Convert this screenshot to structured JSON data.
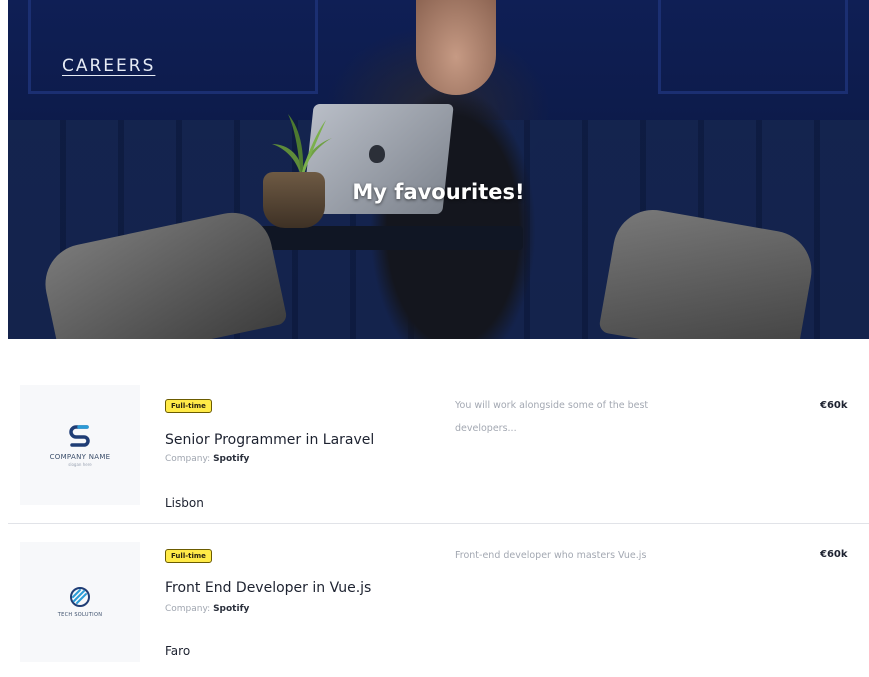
{
  "hero": {
    "nav_link": "CAREERS",
    "title": "My favourites!"
  },
  "jobs": [
    {
      "badge": "Full-time",
      "title": "Senior Programmer in Laravel",
      "company_label": "Company:",
      "company": "Spotify",
      "location": "Lisbon",
      "description": "You will work alongside some of the best developers...",
      "salary": "€60k",
      "logo": {
        "icon": "company-s-logo-icon",
        "text": "COMPANY NAME",
        "tagline": "slogan here"
      }
    },
    {
      "badge": "Full-time",
      "title": "Front End Developer in Vue.js",
      "company_label": "Company:",
      "company": "Spotify",
      "location": "Faro",
      "description": "Front-end developer who masters Vue.js",
      "salary": "€60k",
      "logo": {
        "icon": "tech-solution-logo-icon",
        "text": "TECH SOLUTION"
      }
    }
  ],
  "colors": {
    "hero_blue": "#0f1f55",
    "badge_yellow": "#ffea47",
    "logo_blue": "#2a9bd7"
  }
}
